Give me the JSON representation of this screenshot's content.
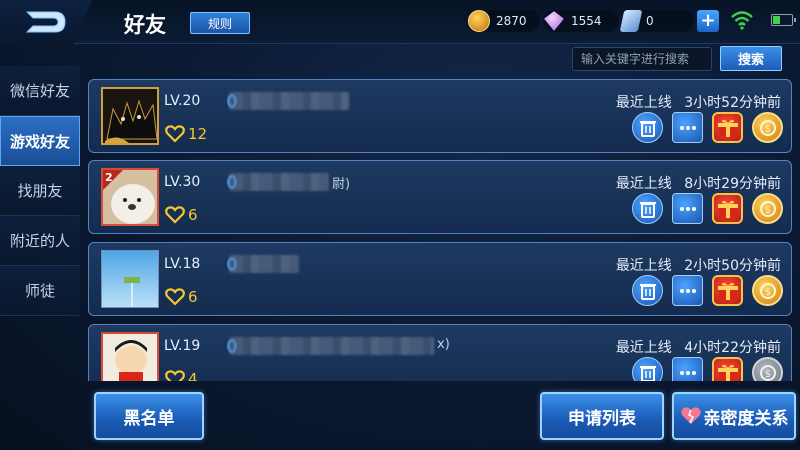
{
  "header": {
    "title": "好友",
    "rules_label": "规则",
    "gold": "2870",
    "diamonds": "1554",
    "vouchers": "0",
    "plus_label": "+"
  },
  "search": {
    "placeholder": "输入关键字进行搜索",
    "button_label": "搜索"
  },
  "sidebar": {
    "items": [
      {
        "label": "微信好友",
        "active": false
      },
      {
        "label": "游戏好友",
        "active": true
      },
      {
        "label": "找朋友",
        "active": false
      },
      {
        "label": "附近的人",
        "active": false
      },
      {
        "label": "师徒",
        "active": false
      }
    ]
  },
  "friends": [
    {
      "level": "LV.20",
      "intimacy": "12",
      "online": "最近上线",
      "time": "3小时52分钟前"
    },
    {
      "level": "LV.30",
      "intimacy": "6",
      "online": "最近上线",
      "time": "8小时29分钟前",
      "name_tail": "尉)"
    },
    {
      "level": "LV.18",
      "intimacy": "6",
      "online": "最近上线",
      "time": "2小时50分钟前"
    },
    {
      "level": "LV.19",
      "intimacy": "4",
      "online": "最近上线",
      "time": "4小时22分钟前",
      "name_tail": "x)"
    }
  ],
  "avatar_badge": "2",
  "footer": {
    "blacklist_label": "黑名单",
    "requests_label": "申请列表",
    "intimacy_label": "亲密度关系"
  },
  "colors": {
    "accent": "#2c6fc4",
    "gold_text": "#f6c72e",
    "background": "#0a1830"
  },
  "icons": {
    "back": "back-arrow-icon",
    "gold": "gold-coin-icon",
    "diamond": "diamond-icon",
    "voucher": "voucher-icon",
    "wifi": "wifi-icon",
    "battery": "battery-icon",
    "delete": "trash-icon",
    "chat": "chat-bubble-icon",
    "gift": "gift-icon",
    "coin": "send-gold-icon",
    "heart": "heart-icon"
  }
}
